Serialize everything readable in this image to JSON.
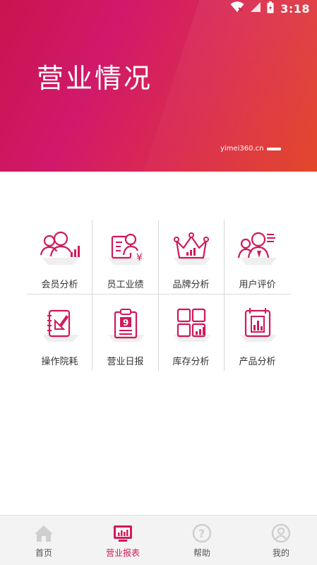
{
  "status_bar": {
    "time": "3:18",
    "icons": [
      "wifi-icon",
      "signal-icon",
      "battery-icon"
    ]
  },
  "banner": {
    "title": "营业情况",
    "site": "yimei360.cn"
  },
  "grid": {
    "items": [
      {
        "label": "会员分析",
        "icon": "member-analysis-icon"
      },
      {
        "label": "员工业绩",
        "icon": "staff-performance-icon"
      },
      {
        "label": "品牌分析",
        "icon": "brand-analysis-icon"
      },
      {
        "label": "用户评价",
        "icon": "user-review-icon"
      },
      {
        "label": "操作院耗",
        "icon": "operation-consumption-icon"
      },
      {
        "label": "营业日报",
        "icon": "daily-report-icon"
      },
      {
        "label": "库存分析",
        "icon": "inventory-analysis-icon"
      },
      {
        "label": "产品分析",
        "icon": "product-analysis-icon"
      }
    ]
  },
  "tabbar": {
    "tabs": [
      {
        "label": "首页",
        "icon": "home-icon",
        "active": false
      },
      {
        "label": "营业报表",
        "icon": "report-icon",
        "active": true
      },
      {
        "label": "帮助",
        "icon": "help-icon",
        "active": false
      },
      {
        "label": "我的",
        "icon": "profile-icon",
        "active": false
      }
    ]
  },
  "colors": {
    "accent": "#d0195c",
    "banner_start": "#c8144e",
    "banner_end": "#e24527",
    "icon_red": "#d0195c"
  }
}
